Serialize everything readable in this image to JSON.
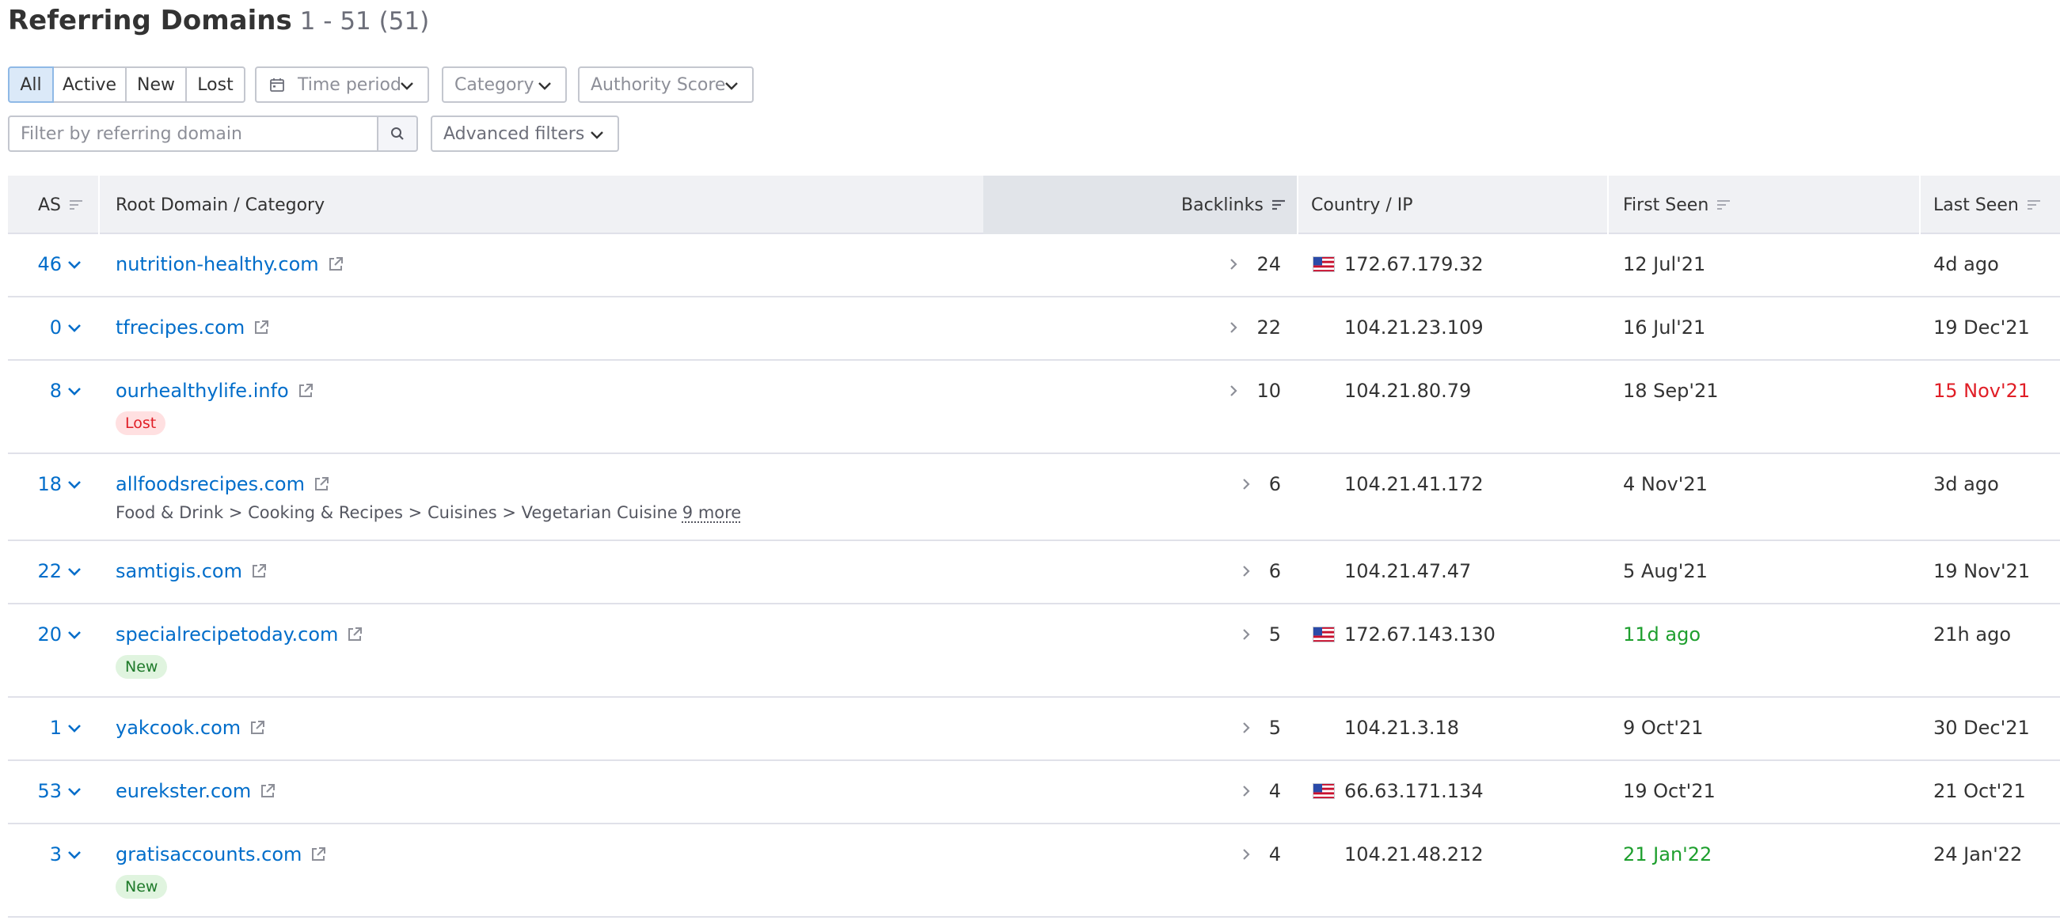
{
  "header": {
    "title": "Referring Domains",
    "count": "1 - 51 (51)"
  },
  "filters": {
    "tabs": [
      "All",
      "Active",
      "New",
      "Lost"
    ],
    "selected_tab": "All",
    "time_period": "Time period",
    "category": "Category",
    "authority_score": "Authority Score",
    "search_placeholder": "Filter by referring domain",
    "advanced": "Advanced filters"
  },
  "table": {
    "columns": {
      "as": "AS",
      "domain": "Root Domain / Category",
      "backlinks": "Backlinks",
      "country": "Country / IP",
      "first_seen": "First Seen",
      "last_seen": "Last Seen"
    },
    "sorted_column": "Backlinks",
    "rows": [
      {
        "as": "46",
        "domain": "nutrition-healthy.com",
        "backlinks": "24",
        "flag": "us-flag",
        "ip": "172.67.179.32",
        "first_seen": "12 Jul'21",
        "first_color": "default",
        "last_seen": "4d ago",
        "last_color": "default"
      },
      {
        "as": "0",
        "domain": "tfrecipes.com",
        "backlinks": "22",
        "ip": "104.21.23.109",
        "first_seen": "16 Jul'21",
        "first_color": "default",
        "last_seen": "19 Dec'21",
        "last_color": "default"
      },
      {
        "as": "8",
        "domain": "ourhealthylife.info",
        "backlinks": "10",
        "ip": "104.21.80.79",
        "first_seen": "18 Sep'21",
        "first_color": "default",
        "last_seen": "15 Nov'21",
        "last_color": "red",
        "badge": "Lost"
      },
      {
        "as": "18",
        "domain": "allfoodsrecipes.com",
        "backlinks": "6",
        "ip": "104.21.41.172",
        "first_seen": "4 Nov'21",
        "first_color": "default",
        "last_seen": "3d ago",
        "last_color": "default",
        "category": "Food & Drink > Cooking & Recipes > Cuisines > Vegetarian Cuisine",
        "category_more": "9 more"
      },
      {
        "as": "22",
        "domain": "samtigis.com",
        "backlinks": "6",
        "ip": "104.21.47.47",
        "first_seen": "5 Aug'21",
        "first_color": "default",
        "last_seen": "19 Nov'21",
        "last_color": "default"
      },
      {
        "as": "20",
        "domain": "specialrecipetoday.com",
        "backlinks": "5",
        "flag": "us-flag",
        "ip": "172.67.143.130",
        "first_seen": "11d ago",
        "first_color": "green",
        "last_seen": "21h ago",
        "last_color": "default",
        "badge": "New"
      },
      {
        "as": "1",
        "domain": "yakcook.com",
        "backlinks": "5",
        "ip": "104.21.3.18",
        "first_seen": "9 Oct'21",
        "first_color": "default",
        "last_seen": "30 Dec'21",
        "last_color": "default"
      },
      {
        "as": "53",
        "domain": "eurekster.com",
        "backlinks": "4",
        "flag": "us-flag",
        "ip": "66.63.171.134",
        "first_seen": "19 Oct'21",
        "first_color": "default",
        "last_seen": "21 Oct'21",
        "last_color": "default"
      },
      {
        "as": "3",
        "domain": "gratisaccounts.com",
        "backlinks": "4",
        "ip": "104.21.48.212",
        "first_seen": "21 Jan'22",
        "first_color": "green",
        "last_seen": "24 Jan'22",
        "last_color": "default",
        "badge": "New"
      }
    ]
  },
  "colors": {
    "link": "#006dca",
    "new_green": "#1e9f2e",
    "lost_red": "#e01e26",
    "header_bg": "#f0f1f4",
    "active_tab_bg": "#dbe9f8"
  }
}
